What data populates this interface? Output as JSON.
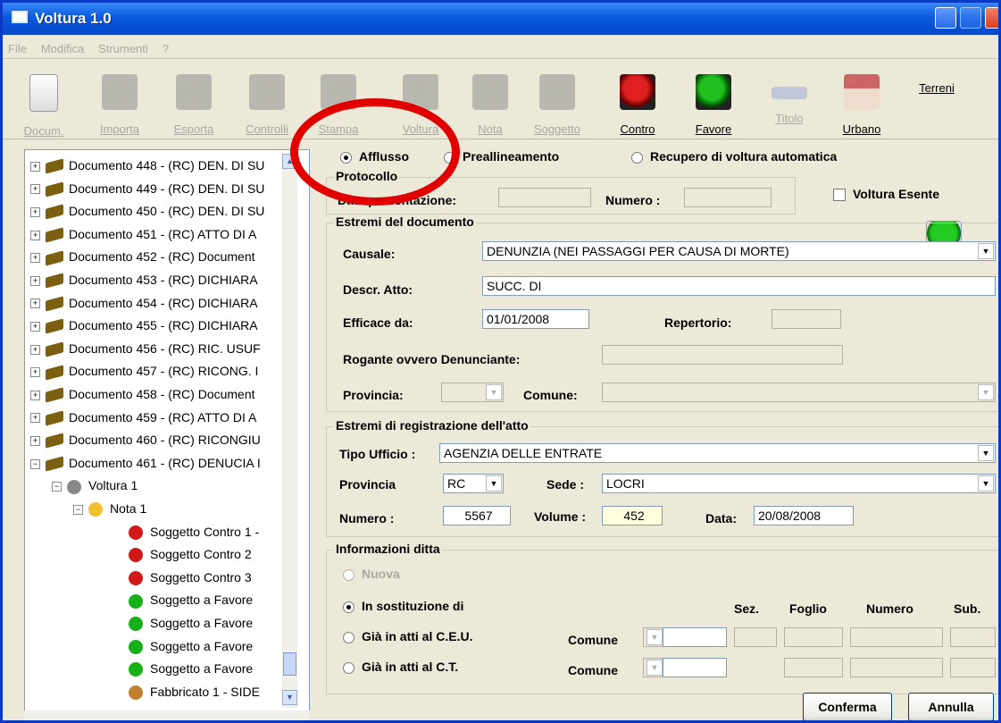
{
  "window": {
    "title": "Voltura 1.0"
  },
  "menu": [
    "File",
    "Modifica",
    "Strumenti",
    "?"
  ],
  "toolbar": [
    {
      "label": "Docum.",
      "icon": "document-icon",
      "enabled": false
    },
    {
      "label": "Importa",
      "icon": "import-icon",
      "enabled": false
    },
    {
      "label": "Esporta",
      "icon": "export-icon",
      "enabled": false
    },
    {
      "label": "Controlli",
      "icon": "check-icon",
      "enabled": false
    },
    {
      "label": "Stampa",
      "icon": "printer-icon",
      "enabled": false
    },
    {
      "label": "Voltura",
      "icon": "voltura-icon",
      "enabled": false
    },
    {
      "label": "Nota",
      "icon": "note-icon",
      "enabled": false
    },
    {
      "label": "Soggetto",
      "icon": "person-icon",
      "enabled": false
    },
    {
      "label": "Contro",
      "icon": "person-red-icon",
      "enabled": true
    },
    {
      "label": "Favore",
      "icon": "person-green-icon",
      "enabled": true
    },
    {
      "label": "Titolo",
      "icon": "title-icon",
      "enabled": false
    },
    {
      "label": "Urbano",
      "icon": "house-icon",
      "enabled": true
    },
    {
      "label": "Terreni",
      "icon": "tree-icon",
      "enabled": true
    }
  ],
  "tree": {
    "documents": [
      "Documento 448 - (RC) DEN. DI SU",
      "Documento 449 - (RC) DEN. DI SU",
      "Documento 450 - (RC) DEN. DI SU",
      "Documento 451 - (RC) ATTO DI A",
      "Documento 452 - (RC) Document",
      "Documento 453 - (RC) DICHIARA",
      "Documento 454 - (RC) DICHIARA",
      "Documento 455 - (RC) DICHIARA",
      "Documento 456 - (RC) RIC. USUF",
      "Documento 457 - (RC) RICONG. I",
      "Documento 458 - (RC) Document",
      "Documento 459 - (RC) ATTO DI A",
      "Documento 460 - (RC) RICONGIU",
      "Documento 461 - (RC) DENUCIA I"
    ],
    "voltura": "Voltura  1",
    "nota": "Nota  1",
    "soggetti": [
      {
        "label": "Soggetto Contro  1 -",
        "kind": "contro"
      },
      {
        "label": "Soggetto Contro  2",
        "kind": "contro"
      },
      {
        "label": "Soggetto Contro  3",
        "kind": "contro"
      },
      {
        "label": "Soggetto a Favore",
        "kind": "favore"
      },
      {
        "label": "Soggetto a Favore",
        "kind": "favore"
      },
      {
        "label": "Soggetto a Favore",
        "kind": "favore"
      },
      {
        "label": "Soggetto a Favore",
        "kind": "favore"
      }
    ],
    "fabbricato": "Fabbricato  1 - SIDE"
  },
  "modes": {
    "afflusso": "Afflusso",
    "preallineamento": "Preallineamento",
    "recupero": "Recupero di voltura automatica",
    "selected": "afflusso"
  },
  "protocollo": {
    "legend": "Protocollo",
    "data_label": "Data presentazione:",
    "numero_label": "Numero :",
    "data": "",
    "numero": ""
  },
  "voltura_esente": {
    "label": "Voltura Esente",
    "checked": false
  },
  "estremi_documento": {
    "legend": "Estremi del documento",
    "causale_label": "Causale:",
    "causale": "DENUNZIA (NEI PASSAGGI PER CAUSA DI MORTE)",
    "descr_label": "Descr. Atto:",
    "descr": "SUCC. DI",
    "efficace_label": "Efficace da:",
    "efficace": "01/01/2008",
    "repertorio_label": "Repertorio:",
    "repertorio": "",
    "rogante_label": "Rogante ovvero Denunciante:",
    "rogante": "",
    "provincia_label": "Provincia:",
    "provincia": "",
    "comune_label": "Comune:",
    "comune": ""
  },
  "estremi_registrazione": {
    "legend": "Estremi di registrazione dell'atto",
    "tipo_label": "Tipo Ufficio :",
    "tipo": "AGENZIA DELLE ENTRATE",
    "provincia_label": "Provincia",
    "provincia": "RC",
    "sede_label": "Sede :",
    "sede": "LOCRI",
    "numero_label": "Numero :",
    "numero": "5567",
    "volume_label": "Volume :",
    "volume": "452",
    "data_label": "Data:",
    "data": "20/08/2008"
  },
  "informazioni_ditta": {
    "legend": "Informazioni ditta",
    "nuova": "Nuova",
    "sostituzione": "In sostituzione di",
    "ceu": "Già in atti al C.E.U.",
    "ct": "Già in atti al C.T.",
    "comune_label": "Comune",
    "sez": "Sez.",
    "foglio": "Foglio",
    "numero": "Numero",
    "sub": "Sub.",
    "selected": "sostituzione"
  },
  "buttons": {
    "conferma": "Conferma",
    "annulla": "Annulla"
  }
}
